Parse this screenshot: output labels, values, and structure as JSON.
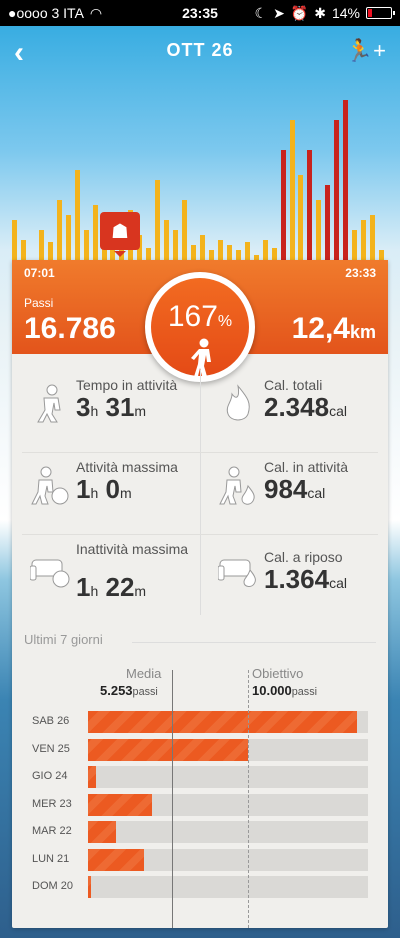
{
  "statusbar": {
    "carrier": "●oooo 3 ITA",
    "time": "23:35",
    "battery": "14%",
    "status_icons": [
      "moon-icon",
      "location-icon",
      "alarm-icon",
      "bluetooth-icon"
    ]
  },
  "header": {
    "title": "OTT 26"
  },
  "summary": {
    "start_time": "07:01",
    "end_time": "23:33",
    "steps_label": "Passi",
    "steps_value": "16.786",
    "goal_percent": "167",
    "goal_percent_unit": "%",
    "distance_value": "12,4",
    "distance_unit": "km"
  },
  "stats": [
    {
      "label": "Tempo in attività",
      "value_main": "3",
      "unit_main": "h",
      "value_sub": "31",
      "unit_sub": "m",
      "icon": "runner-icon"
    },
    {
      "label": "Cal. totali",
      "value_main": "2.348",
      "unit_main": "cal",
      "value_sub": "",
      "unit_sub": "",
      "icon": "flame-icon"
    },
    {
      "label": "Attività massima",
      "value_main": "1",
      "unit_main": "h",
      "value_sub": "0",
      "unit_sub": "m",
      "icon": "runner-clock-icon"
    },
    {
      "label": "Cal. in attività",
      "value_main": "984",
      "unit_main": "cal",
      "value_sub": "",
      "unit_sub": "",
      "icon": "runner-flame-icon"
    },
    {
      "label": "Inattività massima",
      "value_main": "1",
      "unit_main": "h",
      "value_sub": "22",
      "unit_sub": "m",
      "icon": "sofa-clock-icon"
    },
    {
      "label": "Cal. a riposo",
      "value_main": "1.364",
      "unit_main": "cal",
      "value_sub": "",
      "unit_sub": "",
      "icon": "sofa-flame-icon"
    }
  ],
  "week": {
    "title": "Ultimi 7 giorni",
    "media_label": "Media",
    "media_value": "5.253",
    "media_unit": "passi",
    "goal_label": "Obiettivo",
    "goal_value": "10.000",
    "goal_unit": "passi",
    "days": [
      {
        "label": "SAB 26",
        "progress": 0.96
      },
      {
        "label": "VEN 25",
        "progress": 0.57
      },
      {
        "label": "GIO 24",
        "progress": 0.03
      },
      {
        "label": "MER 23",
        "progress": 0.23
      },
      {
        "label": "MAR 22",
        "progress": 0.1
      },
      {
        "label": "LUN 21",
        "progress": 0.2
      },
      {
        "label": "DOM 20",
        "progress": 0.01
      }
    ]
  },
  "colors": {
    "accent_orange": "#e85a1f",
    "histogram_yellow": "#f3b31c",
    "histogram_red": "#c8231d"
  }
}
